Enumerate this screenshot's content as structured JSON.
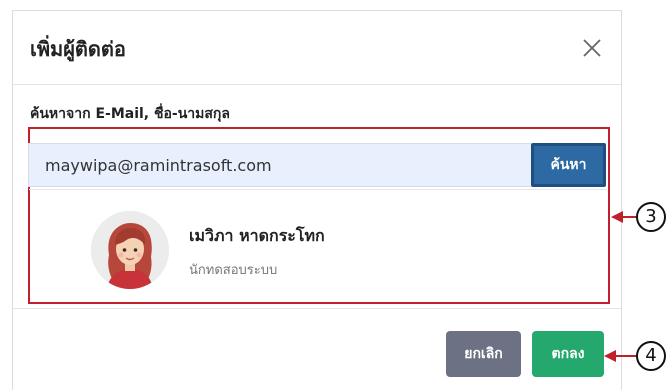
{
  "dialog": {
    "title": "เพิ่มผู้ติดต่อ",
    "close_icon": "close-icon"
  },
  "search": {
    "label": "ค้นหาจาก E-Mail, ชื่อ-นามสกุล",
    "value": "maywipa@ramintrasoft.com",
    "button_label": "ค้นหา",
    "button_color": "#2d6aa3"
  },
  "result": {
    "avatar_icon": "user-avatar",
    "name": "เมวิภา หาดกระโทก",
    "role": "นักทดสอบระบบ"
  },
  "footer": {
    "cancel_label": "ยกเลิก",
    "ok_label": "ตกลง",
    "cancel_color": "#6c7283",
    "ok_color": "#25a86e"
  },
  "annotations": {
    "callout_3": "3",
    "callout_4": "4",
    "highlight_color": "#c0202a"
  }
}
